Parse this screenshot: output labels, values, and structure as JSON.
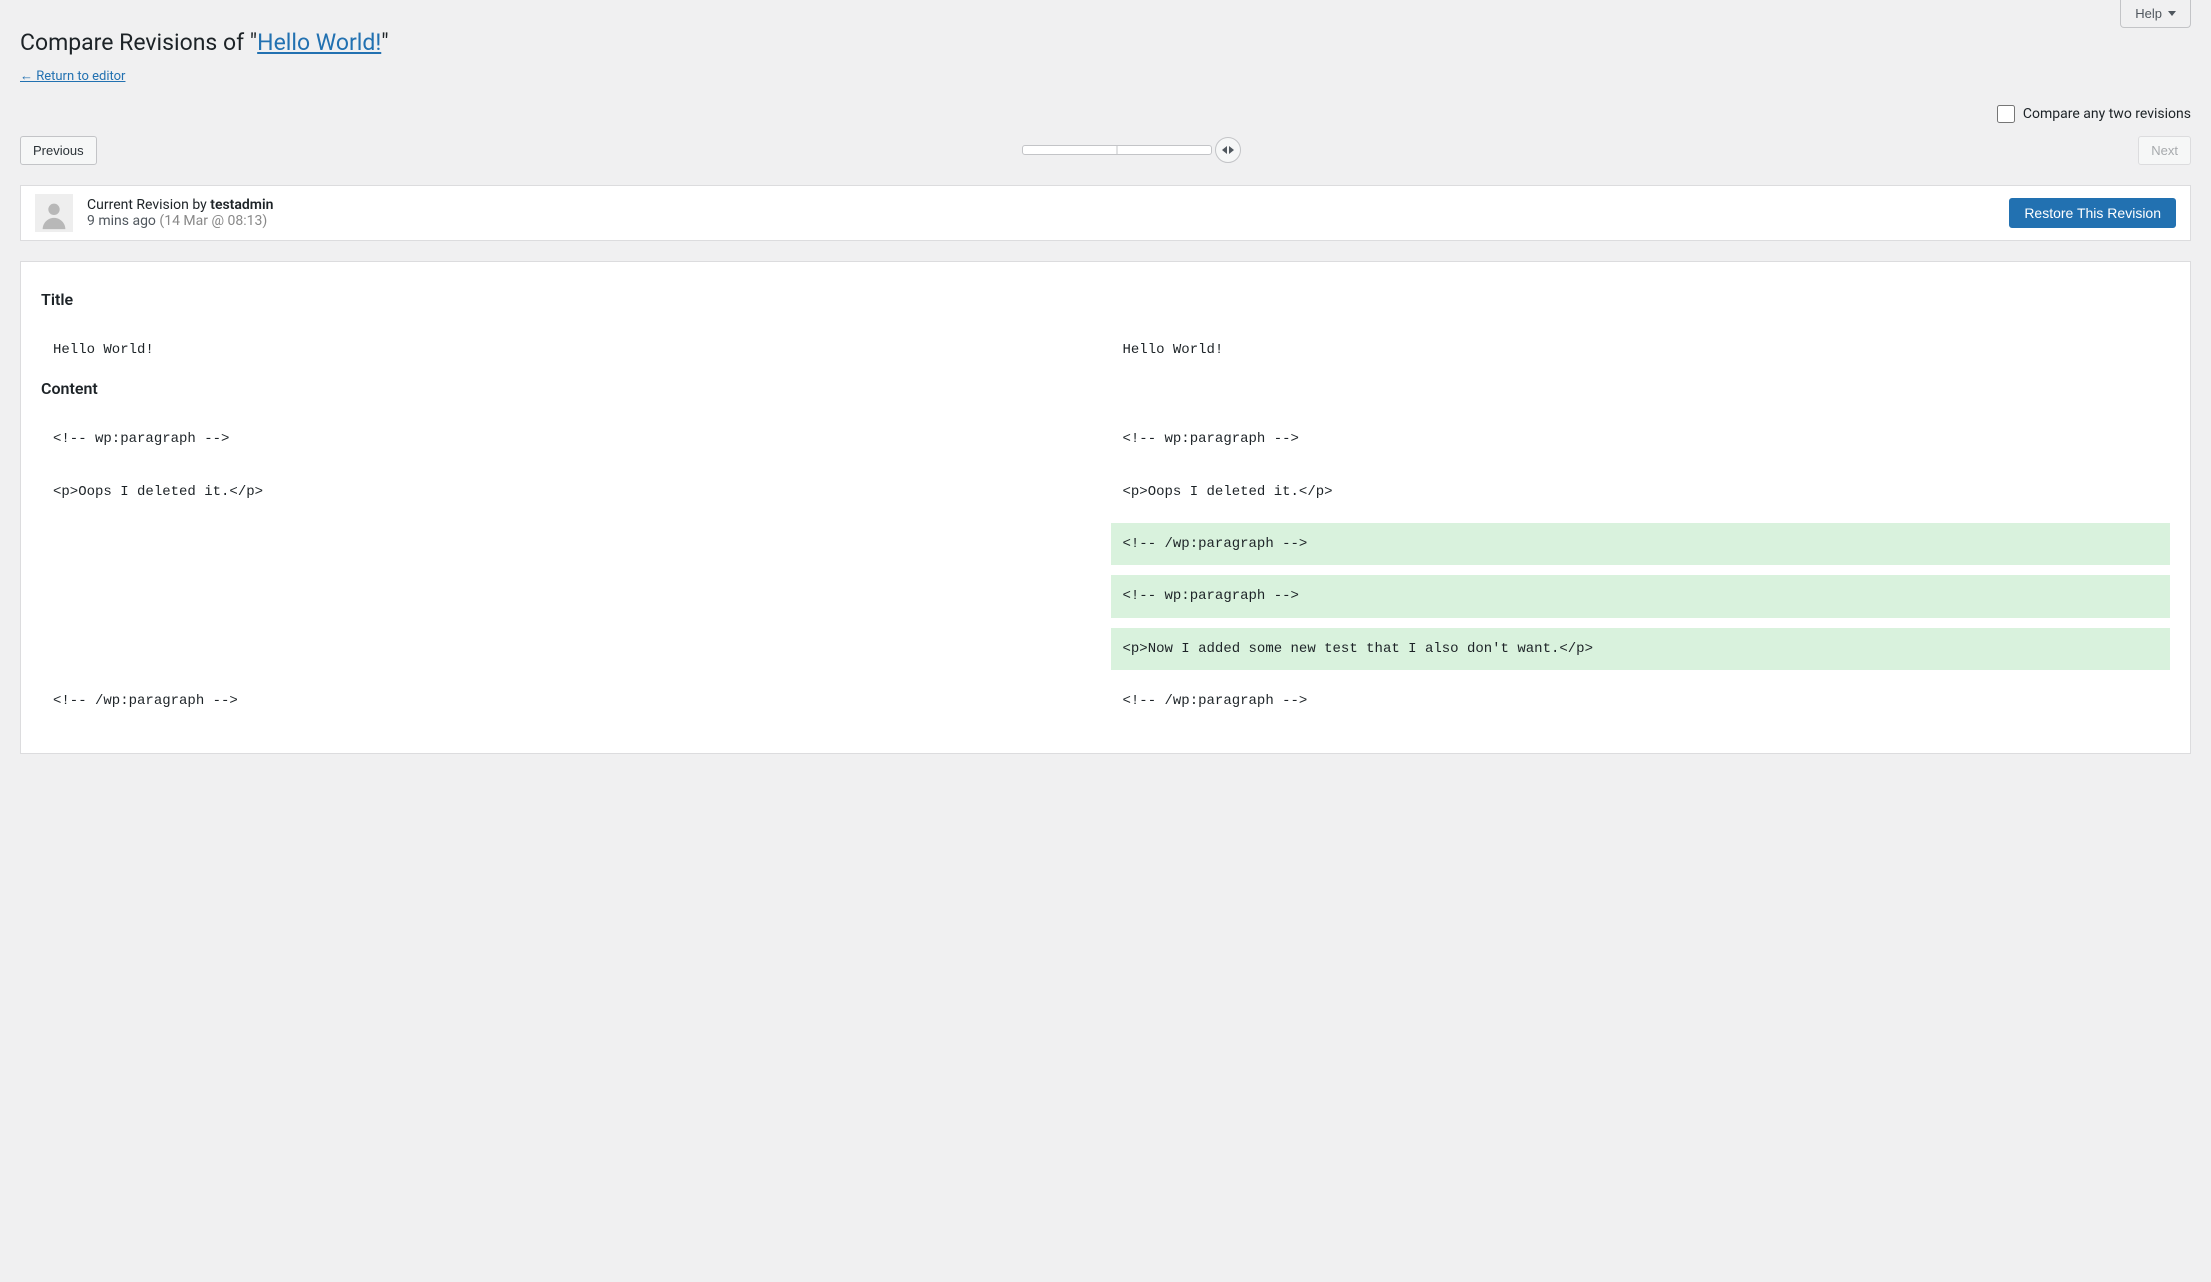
{
  "help_label": "Help",
  "heading": {
    "prefix": "Compare Revisions of \"",
    "link_text": "Hello World!",
    "suffix": "\""
  },
  "return_link": "← Return to editor",
  "compare_any_label": "Compare any two revisions",
  "nav": {
    "previous": "Previous",
    "next": "Next"
  },
  "revision_header": {
    "prefix": "Current Revision by ",
    "author": "testadmin",
    "time_ago": "9 mins ago",
    "timestamp": "(14 Mar @ 08:13)",
    "restore_label": "Restore This Revision"
  },
  "diff": {
    "sections": [
      {
        "heading": "Title",
        "rows": [
          {
            "left": "Hello World!",
            "right": "Hello World!",
            "status": "context"
          }
        ]
      },
      {
        "heading": "Content",
        "rows": [
          {
            "left": "<!-- wp:paragraph -->",
            "right": "<!-- wp:paragraph -->",
            "status": "context"
          },
          {
            "left": "<p>Oops I deleted it.</p>",
            "right": "<p>Oops I deleted it.</p>",
            "status": "context"
          },
          {
            "left": "",
            "right": "<!-- /wp:paragraph -->",
            "status": "added"
          },
          {
            "left": "",
            "right": "<!-- wp:paragraph -->",
            "status": "added"
          },
          {
            "left": "",
            "right": "<p>Now I added some new test that I also don't want.</p>",
            "status": "added"
          },
          {
            "left": "<!-- /wp:paragraph -->",
            "right": "<!-- /wp:paragraph -->",
            "status": "context"
          }
        ]
      }
    ]
  }
}
